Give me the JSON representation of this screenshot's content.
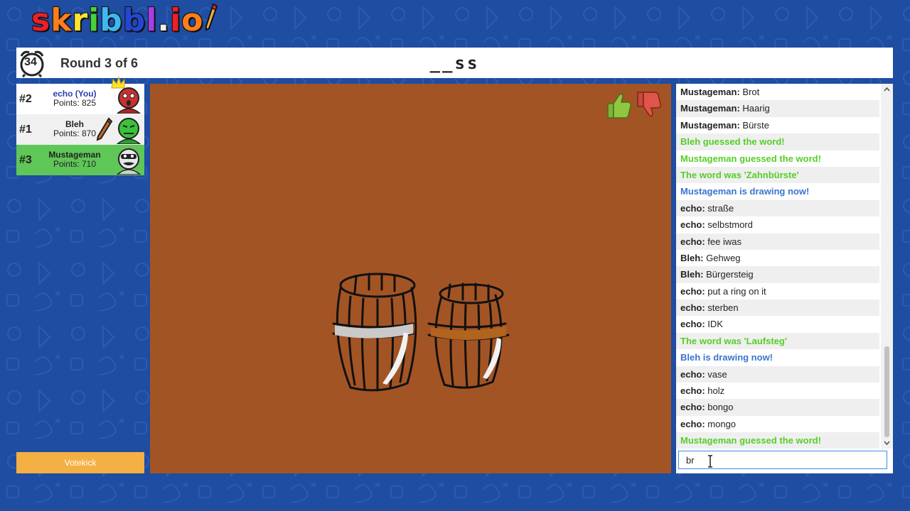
{
  "logo": {
    "text": "skribbl.io",
    "letters": [
      "s",
      "k",
      "r",
      "i",
      "b",
      "b",
      "l",
      ".",
      "i",
      "o"
    ],
    "colors": [
      "#ef1f25",
      "#ff7d1a",
      "#ffe234",
      "#47d33a",
      "#3fb8f2",
      "#2546d4",
      "#a83ee3",
      "#eeeeee",
      "#ef1f25",
      "#ff7d1a"
    ]
  },
  "header": {
    "timer": "34",
    "round": "Round 3 of 6",
    "word_hint": "__ss"
  },
  "players": [
    {
      "rank": "#2",
      "name": "echo (You)",
      "points": "Points: 825",
      "is_you": true,
      "avatar_color": "#c93030",
      "has_crown": true,
      "is_drawing": false
    },
    {
      "rank": "#1",
      "name": "Bleh",
      "points": "Points: 870",
      "is_you": false,
      "avatar_color": "#3bc23b",
      "has_crown": false,
      "has_pencil": true,
      "is_drawing": false
    },
    {
      "rank": "#3",
      "name": "Mustageman",
      "points": "Points: 710",
      "is_you": false,
      "avatar_color": "#e8e8e8",
      "has_crown": false,
      "is_drawing": true
    }
  ],
  "votekick": "Votekick",
  "chat": {
    "messages": [
      {
        "type": "msg",
        "who": "Mustageman:",
        "text": " Brot"
      },
      {
        "type": "msg",
        "who": "Mustageman:",
        "text": " Haarig"
      },
      {
        "type": "msg",
        "who": "Mustageman:",
        "text": " Bürste"
      },
      {
        "type": "guessed",
        "who": "",
        "text": "Bleh guessed the word!"
      },
      {
        "type": "guessed",
        "who": "",
        "text": "Mustageman guessed the word!"
      },
      {
        "type": "reveal",
        "who": "",
        "text": "The word was 'Zahnbürste'"
      },
      {
        "type": "drawnow",
        "who": "",
        "text": "Mustageman is drawing now!"
      },
      {
        "type": "msg",
        "who": "echo:",
        "text": " straße"
      },
      {
        "type": "msg",
        "who": "echo:",
        "text": " selbstmord"
      },
      {
        "type": "msg",
        "who": "echo:",
        "text": " fee iwas"
      },
      {
        "type": "msg",
        "who": "Bleh:",
        "text": " Gehweg"
      },
      {
        "type": "msg",
        "who": "Bleh:",
        "text": " Bürgersteig"
      },
      {
        "type": "msg",
        "who": "echo:",
        "text": " put a ring on it"
      },
      {
        "type": "msg",
        "who": "echo:",
        "text": " sterben"
      },
      {
        "type": "msg",
        "who": "echo:",
        "text": " IDK"
      },
      {
        "type": "reveal",
        "who": "",
        "text": "The word was 'Laufsteg'"
      },
      {
        "type": "drawnow",
        "who": "",
        "text": "Bleh is drawing now!"
      },
      {
        "type": "msg",
        "who": "echo:",
        "text": " vase"
      },
      {
        "type": "msg",
        "who": "echo:",
        "text": " holz"
      },
      {
        "type": "msg",
        "who": "echo:",
        "text": " bongo"
      },
      {
        "type": "msg",
        "who": "echo:",
        "text": " mongo"
      },
      {
        "type": "guessed",
        "who": "",
        "text": "Mustageman guessed the word!"
      }
    ],
    "input_value": "br"
  },
  "colors": {
    "background": "#1e4da1",
    "canvas": "#a35424",
    "guessed": "#56ce27",
    "drawing_now": "#3975ce",
    "votekick": "#f4b042",
    "drawer_highlight": "#5fc658"
  },
  "icons": [
    "alarm-clock-icon",
    "crown-icon",
    "pencil-icon",
    "thumbs-up-icon",
    "thumbs-down-icon",
    "scroll-up-icon",
    "scroll-down-icon",
    "text-cursor-icon"
  ]
}
